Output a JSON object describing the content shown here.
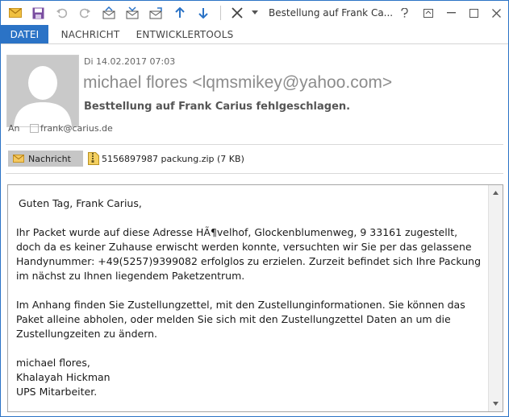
{
  "window": {
    "title": "Bestellung auf Frank Ca...",
    "colors": {
      "accent": "#2b73c6",
      "attachment_active": "#c6c6c6"
    }
  },
  "quick_access": {
    "icons": [
      "mail-icon",
      "save-icon",
      "undo-icon",
      "redo-icon",
      "previous-item-icon",
      "next-item-icon",
      "up-arrow-icon",
      "down-arrow-icon",
      "delete-icon",
      "customize-dropdown-icon"
    ]
  },
  "window_controls": [
    "help-icon",
    "restore-ribbon-icon",
    "minimize-icon",
    "maximize-icon",
    "close-icon"
  ],
  "tabs": [
    {
      "label": "DATEI"
    },
    {
      "label": "NACHRICHT"
    },
    {
      "label": "ENTWICKLERTOOLS"
    }
  ],
  "header": {
    "date": "Di 14.02.2017 07:03",
    "sender": "michael flores <lqmsmikey@yahoo.com>",
    "subject": "Besttellung auf Frank Carius fehlgeschlagen.",
    "to_label": "An",
    "to_address": "frank@carius.de"
  },
  "attachments": {
    "message_tab": "Nachricht",
    "file": "5156897987 packung.zip (7 KB)"
  },
  "body": {
    "greeting": "Guten Tag, Frank Carius,",
    "p1": "Ihr Packet wurde auf diese Adresse HÃ¶velhof, Glockenblumenweg, 9 33161 zugestellt, doch da es keiner Zuhause erwischt werden konnte, versuchten wir Sie per das gelassene Handynummer: +49(5257)9399082 erfolglos zu erzielen. Zurzeit befindet sich Ihre Packung im nächst zu Ihnen liegendem Paketzentrum.",
    "p2": "Im Anhang finden Sie Zustellungzettel, mit den Zustellunginformationen. Sie können das Paket alleine abholen, oder melden Sie sich mit den Zustellungzettel Daten an um die Zustellungzeiten zu ändern.",
    "sig1": "michael flores,",
    "sig2": "Khalayah Hickman",
    "sig3": "UPS Mitarbeiter."
  }
}
